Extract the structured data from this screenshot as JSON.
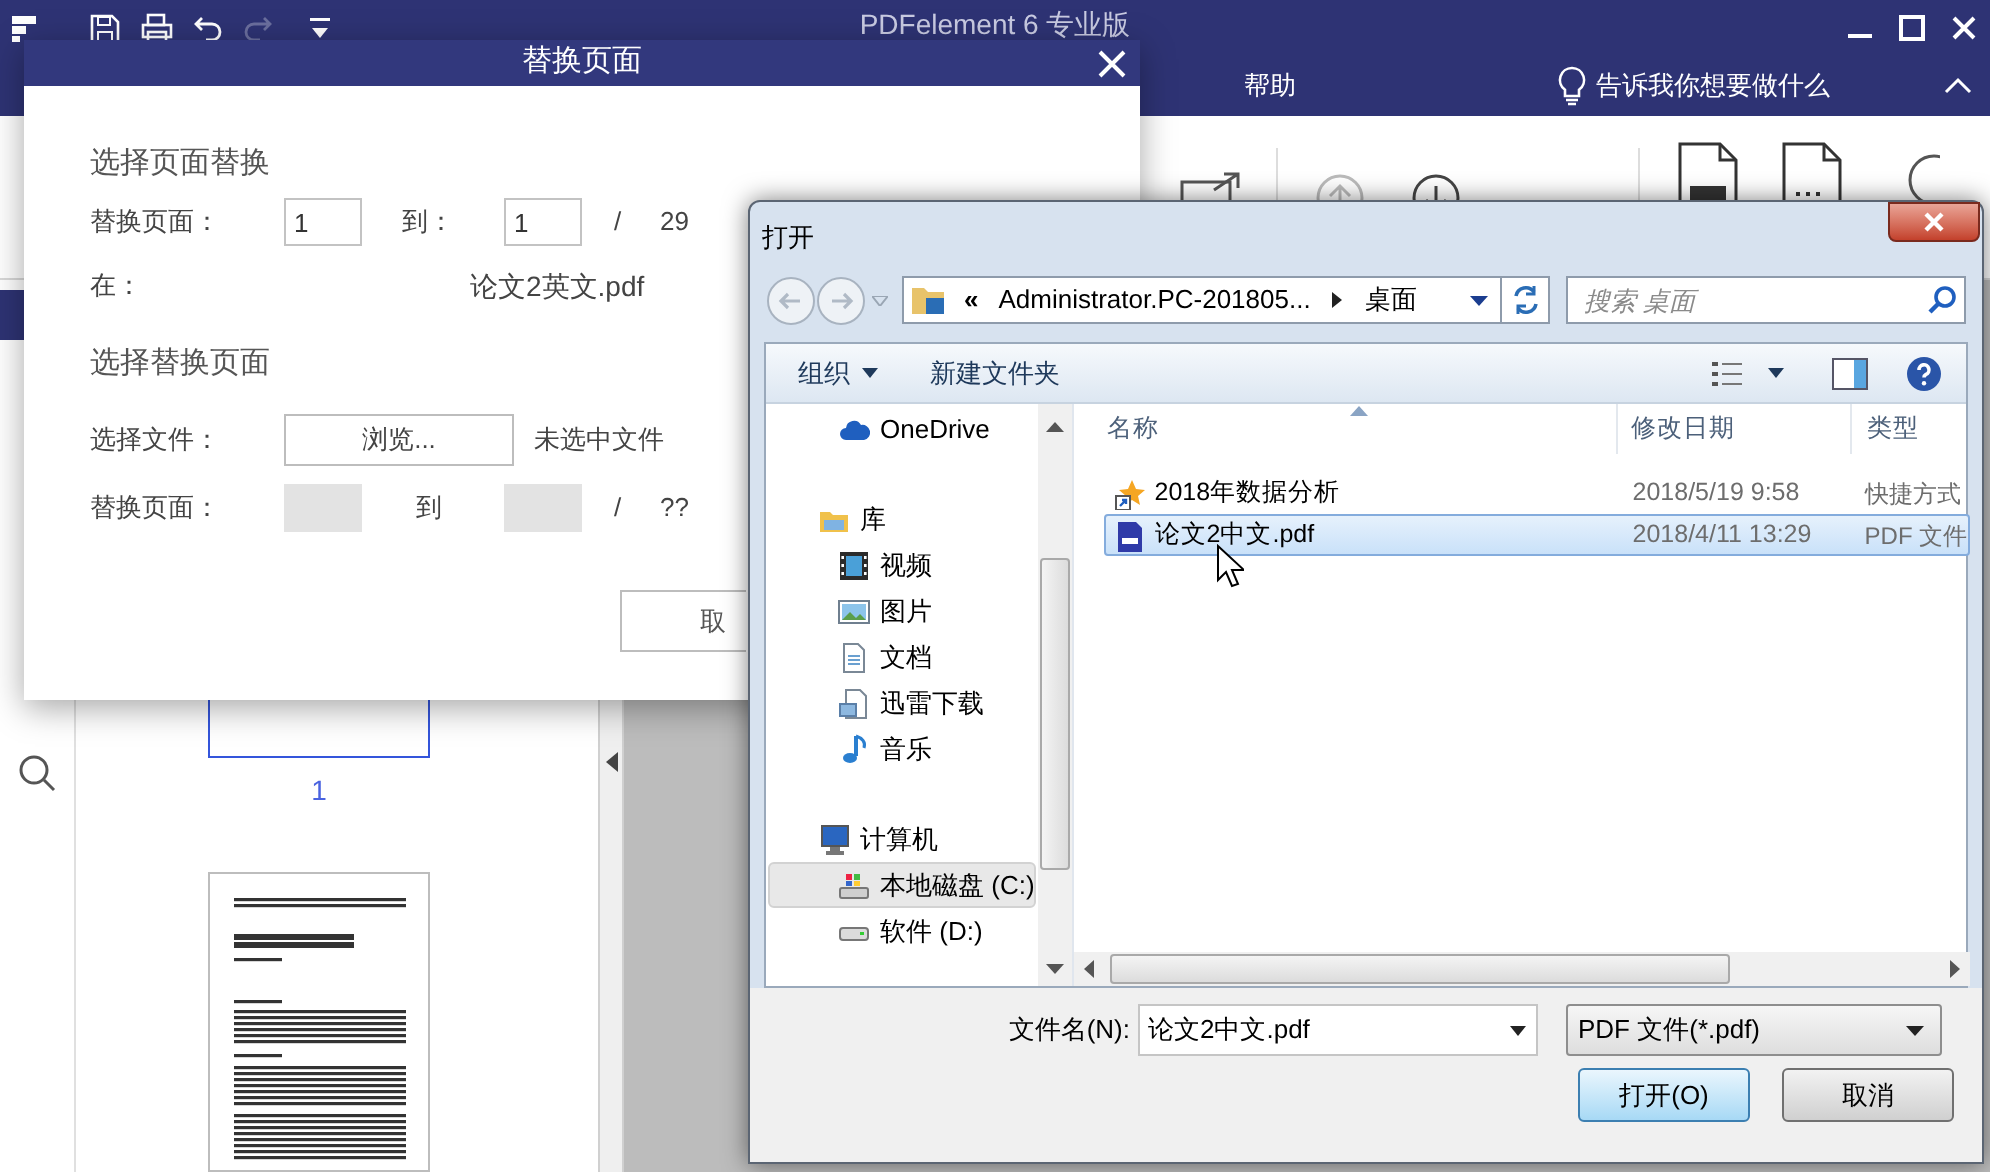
{
  "app": {
    "title": "PDFelement 6 专业版",
    "menu": [
      "帮助"
    ],
    "tell_me": "告诉我你想要做什么",
    "thumbnails": [
      {
        "label": "1",
        "selected": true
      },
      {
        "selected": false
      }
    ]
  },
  "replace_dialog": {
    "title": "替换页面",
    "source_heading": "选择页面替换",
    "source_range": {
      "label": "替换页面：",
      "from": "1",
      "to_label": "到：",
      "to": "1",
      "separator": "/",
      "total": "29"
    },
    "location": {
      "label": "在：",
      "value": "论文2英文.pdf"
    },
    "target_heading": "选择替换页面",
    "file": {
      "label": "选择文件：",
      "button": "浏览...",
      "status": "未选中文件"
    },
    "target_range": {
      "label": "替换页面：",
      "to_label": "到",
      "separator": "/",
      "total": "??",
      "disabled": true
    },
    "cancel_button": "取"
  },
  "open_dialog": {
    "title": "打开",
    "address": {
      "overflow": "«",
      "path": "Administrator.PC-201805...",
      "folder": "桌面"
    },
    "search": {
      "placeholder": "搜索 桌面"
    },
    "toolbar": {
      "organize": "组织",
      "new_folder": "新建文件夹"
    },
    "nav": [
      {
        "kind": "cloud",
        "label": "OneDrive",
        "selected": false
      },
      {
        "kind": "library",
        "label": "库",
        "selected": false,
        "children": [
          {
            "kind": "video",
            "label": "视频",
            "selected": false
          },
          {
            "kind": "pictures",
            "label": "图片",
            "selected": false
          },
          {
            "kind": "documents",
            "label": "文档",
            "selected": false
          },
          {
            "kind": "download",
            "label": "迅雷下载",
            "selected": false
          },
          {
            "kind": "music",
            "label": "音乐",
            "selected": false
          }
        ]
      },
      {
        "kind": "computer",
        "label": "计算机",
        "selected": false,
        "children": [
          {
            "kind": "drive_c",
            "label": "本地磁盘 (C:)",
            "selected": true
          },
          {
            "kind": "drive",
            "label": "软件 (D:)",
            "selected": false
          }
        ]
      }
    ],
    "columns": [
      "名称",
      "修改日期",
      "类型"
    ],
    "files": [
      {
        "kind": "shortcut",
        "name": "2018年数据分析",
        "date": "2018/5/19 9:58",
        "type": "快捷方式",
        "selected": false
      },
      {
        "kind": "pdf",
        "name": "论文2中文.pdf",
        "date": "2018/4/11 13:29",
        "type": "PDF 文件",
        "selected": true
      }
    ],
    "file_name_label": "文件名(N):",
    "file_name": "论文2中文.pdf",
    "file_type": "PDF 文件(*.pdf)",
    "open_button": "打开(O)",
    "cancel_button": "取消"
  }
}
